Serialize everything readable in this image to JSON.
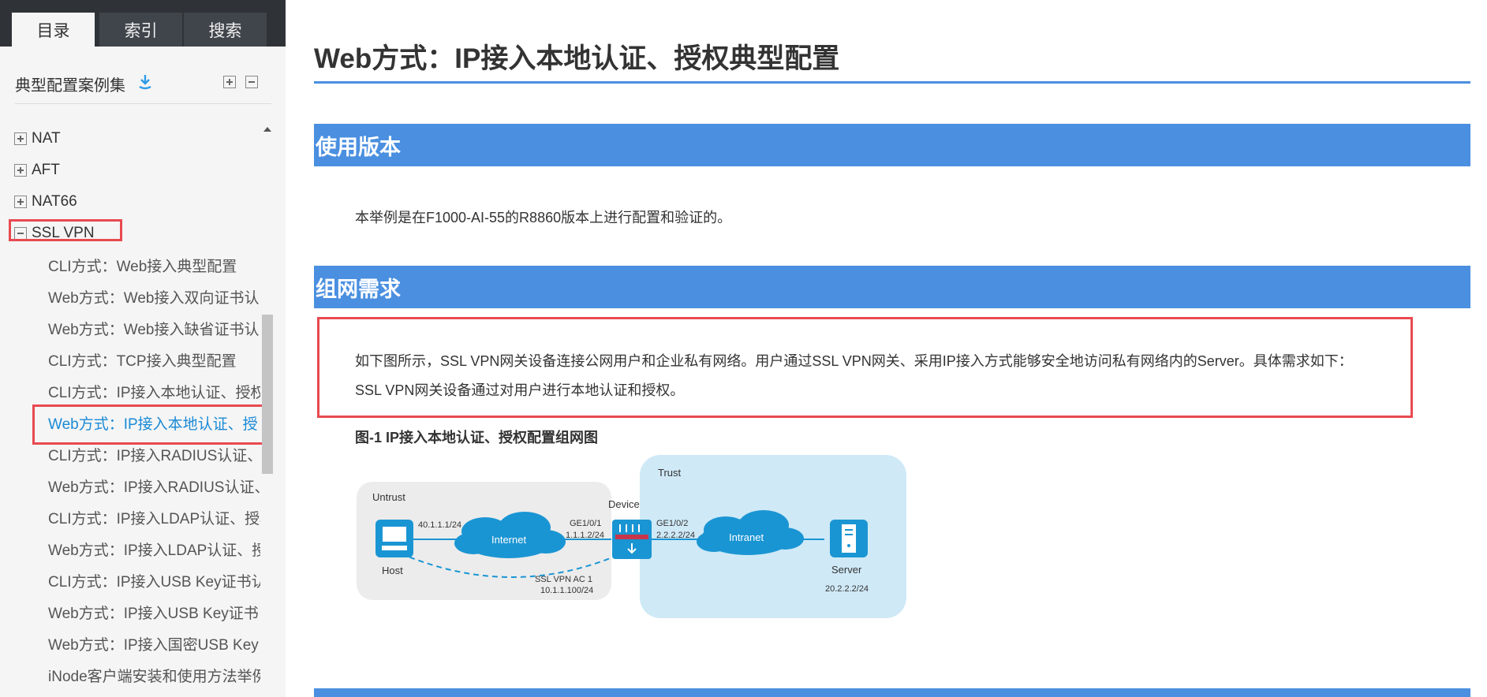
{
  "tabs": [
    {
      "label": "目录",
      "active": true
    },
    {
      "label": "索引",
      "active": false
    },
    {
      "label": "搜索",
      "active": false
    }
  ],
  "toc": {
    "title": "典型配置案例集",
    "sync_icon": "sync-arrow-icon",
    "expand_icon": "expand-all-icon",
    "collapse_icon": "collapse-all-icon",
    "items": [
      {
        "label": "NAT",
        "expanded": false
      },
      {
        "label": "AFT",
        "expanded": false
      },
      {
        "label": "NAT66",
        "expanded": false
      },
      {
        "label": "SSL VPN",
        "expanded": true
      }
    ],
    "children": [
      "CLI方式：Web接入典型配置",
      "Web方式：Web接入双向证书认",
      "Web方式：Web接入缺省证书认",
      "CLI方式：TCP接入典型配置",
      "CLI方式：IP接入本地认证、授权",
      "Web方式：IP接入本地认证、授",
      "CLI方式：IP接入RADIUS认证、",
      "Web方式：IP接入RADIUS认证、",
      "CLI方式：IP接入LDAP认证、授权",
      "Web方式：IP接入LDAP认证、授",
      "CLI方式：IP接入USB Key证书认",
      "Web方式：IP接入USB Key证书",
      "Web方式：IP接入国密USB Key",
      "iNode客户端安装和使用方法举例"
    ],
    "selected_child_index": 5
  },
  "content": {
    "title": "Web方式：IP接入本地认证、授权典型配置",
    "sections": [
      {
        "heading": "使用版本"
      },
      {
        "heading": "组网需求"
      }
    ],
    "version_text": "本举例是在F1000-AI-55的R8860版本上进行配置和验证的。",
    "requirement_line1": "如下图所示，SSL VPN网关设备连接公网用户和企业私有网络。用户通过SSL VPN网关、采用IP接入方式能够安全地访问私有网络内的Server。具体需求如下：",
    "requirement_line2": "SSL VPN网关设备通过对用户进行本地认证和授权。",
    "figure_caption": "图-1 IP接入本地认证、授权配置组网图"
  },
  "diagram": {
    "untrust_label": "Untrust",
    "trust_label": "Trust",
    "device_label": "Device",
    "host_label": "Host",
    "host_ip": "40.1.1.1/24",
    "internet_label": "Internet",
    "intranet_label": "Intranet",
    "ge1_label": "GE1/0/1",
    "ge1_ip": "1.1.1.2/24",
    "ge2_label": "GE1/0/2",
    "ge2_ip": "2.2.2.2/24",
    "ac_label": "SSL VPN AC 1",
    "ac_ip": "10.1.1.100/24",
    "server_label": "Server",
    "server_ip": "20.2.2.2/24",
    "colors": {
      "accent": "#4a8fe0",
      "highlight": "#e84a50",
      "node": "#1a95d3",
      "trust_zone": "#cfe9f7",
      "untrust_zone": "#ececec"
    }
  }
}
